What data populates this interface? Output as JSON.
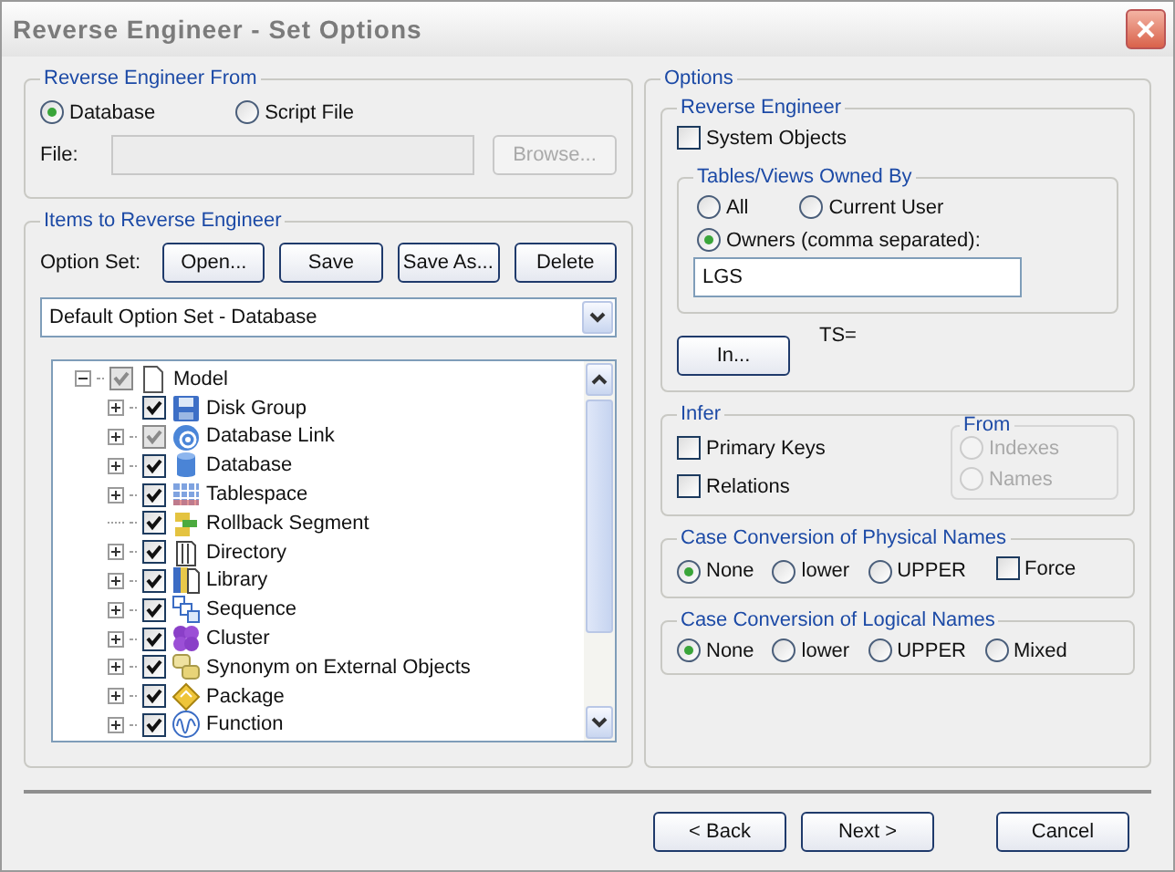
{
  "window": {
    "title": "Reverse Engineer - Set Options"
  },
  "source": {
    "title": "Reverse Engineer From",
    "options": [
      {
        "label": "Database",
        "selected": true
      },
      {
        "label": "Script File",
        "selected": false
      }
    ],
    "file_label": "File:",
    "file_disabled": true,
    "browse": {
      "label": "Browse...",
      "disabled": true
    }
  },
  "items": {
    "title": "Items to Reverse Engineer",
    "option_set_label": "Option Set:",
    "buttons": [
      "Open...",
      "Save",
      "Save As...",
      "Delete"
    ],
    "option_set": "Default Option Set - Database",
    "tree": [
      {
        "label": "Model",
        "kind": "document",
        "expandable": true,
        "expanded": true,
        "checked": true,
        "mixed": true,
        "children": [
          {
            "label": "Disk Group",
            "kind": "disk",
            "expandable": true,
            "expanded": false,
            "checked": true,
            "mixed": false
          },
          {
            "label": "Database Link",
            "kind": "link",
            "expandable": true,
            "expanded": false,
            "checked": true,
            "mixed": true
          },
          {
            "label": "Database",
            "kind": "database",
            "expandable": true,
            "expanded": false,
            "checked": true,
            "mixed": false
          },
          {
            "label": "Tablespace",
            "kind": "tablespace",
            "expandable": true,
            "expanded": false,
            "checked": true,
            "mixed": false
          },
          {
            "label": "Rollback Segment",
            "kind": "rollback",
            "expandable": false,
            "checked": true,
            "mixed": false
          },
          {
            "label": "Directory",
            "kind": "directory",
            "expandable": true,
            "expanded": false,
            "checked": true,
            "mixed": false
          },
          {
            "label": "Library",
            "kind": "library",
            "expandable": true,
            "expanded": false,
            "checked": true,
            "mixed": false
          },
          {
            "label": "Sequence",
            "kind": "sequence",
            "expandable": true,
            "expanded": false,
            "checked": true,
            "mixed": false
          },
          {
            "label": "Cluster",
            "kind": "cluster",
            "expandable": true,
            "expanded": false,
            "checked": true,
            "mixed": false
          },
          {
            "label": "Synonym on External Objects",
            "kind": "synonym",
            "expandable": true,
            "expanded": false,
            "checked": true,
            "mixed": false
          },
          {
            "label": "Package",
            "kind": "package",
            "expandable": true,
            "expanded": false,
            "checked": true,
            "mixed": false
          },
          {
            "label": "Function",
            "kind": "function",
            "expandable": true,
            "expanded": false,
            "checked": true,
            "mixed": false
          }
        ]
      }
    ]
  },
  "options": {
    "title": "Options",
    "reverse": {
      "title": "Reverse Engineer",
      "system_objects": {
        "label": "System Objects",
        "checked": false
      },
      "owned_by": {
        "title": "Tables/Views Owned By",
        "options": [
          {
            "label": "All",
            "selected": false
          },
          {
            "label": "Current User",
            "selected": false
          },
          {
            "label": "Owners (comma separated):",
            "selected": true
          }
        ],
        "owners": "LGS"
      },
      "in_button": "In...",
      "ts_label": "TS="
    },
    "infer": {
      "title": "Infer",
      "checks": [
        {
          "label": "Primary Keys",
          "checked": false
        },
        {
          "label": "Relations",
          "checked": false
        }
      ],
      "from": {
        "title": "From",
        "disabled": true,
        "options": [
          {
            "label": "Indexes",
            "selected": false
          },
          {
            "label": "Names",
            "selected": false
          }
        ]
      }
    },
    "physical": {
      "title": "Case Conversion of Physical Names",
      "options": [
        {
          "label": "None",
          "selected": true
        },
        {
          "label": "lower",
          "selected": false
        },
        {
          "label": "UPPER",
          "selected": false
        }
      ],
      "force": {
        "label": "Force",
        "checked": false
      }
    },
    "logical": {
      "title": "Case Conversion of Logical Names",
      "options": [
        {
          "label": "None",
          "selected": true
        },
        {
          "label": "lower",
          "selected": false
        },
        {
          "label": "UPPER",
          "selected": false
        },
        {
          "label": "Mixed",
          "selected": false
        }
      ]
    }
  },
  "buttons": [
    "< Back",
    "Next >",
    "Cancel"
  ]
}
